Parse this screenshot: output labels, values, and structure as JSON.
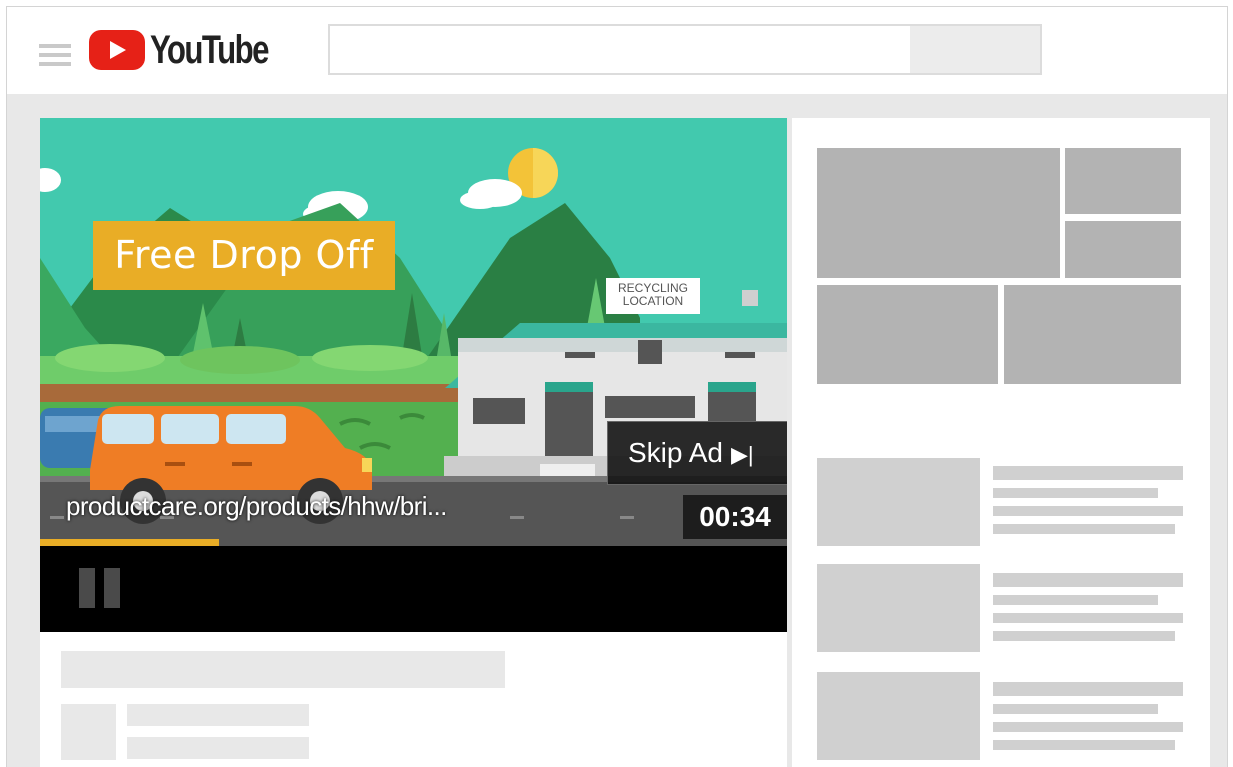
{
  "header": {
    "logo_text": "YouTube",
    "search": {
      "placeholder": ""
    }
  },
  "video_ad": {
    "banner_text": "Free Drop Off",
    "sign_line1": "RECYCLING",
    "sign_line2": "LOCATION",
    "skip_label": "Skip Ad",
    "skip_icon": "▶|",
    "url_text": "productcare.org/products/hhw/bri...",
    "timer": "00:34",
    "progress_fraction": 0.24
  },
  "colors": {
    "brand_red": "#e62117",
    "ad_yellow": "#e9ad26",
    "sky": "#42c9ae"
  }
}
